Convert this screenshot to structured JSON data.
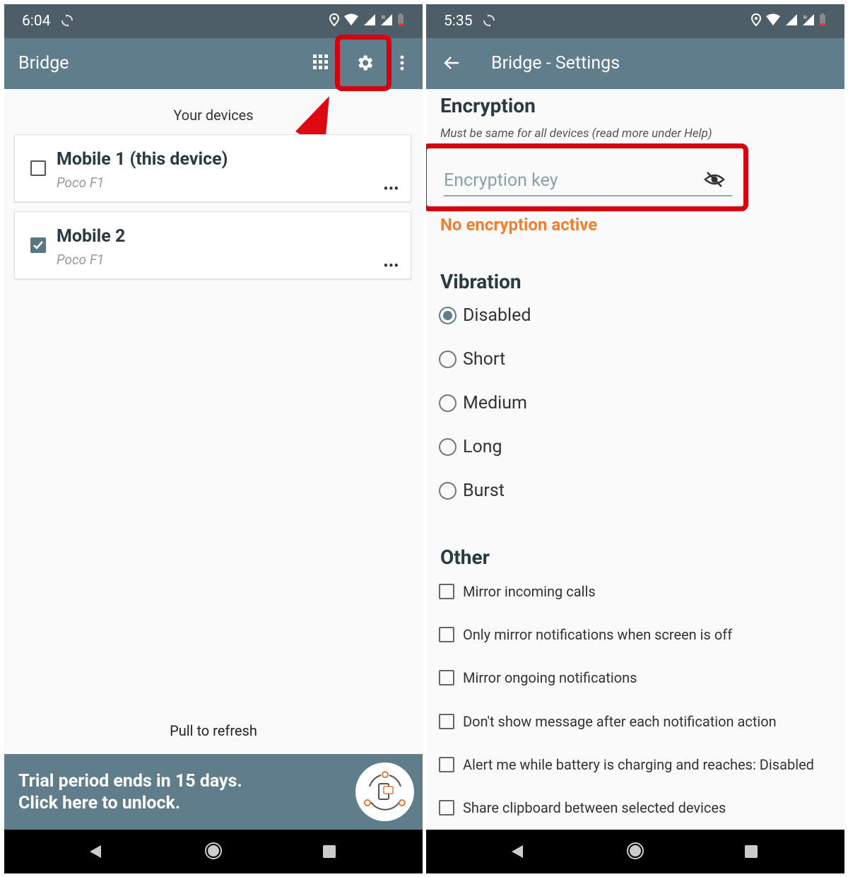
{
  "left": {
    "status_time": "6:04",
    "app_title": "Bridge",
    "section_label": "Your devices",
    "devices": [
      {
        "name": "Mobile 1 (this device)",
        "model": "Poco F1",
        "checked": false,
        "more": "•••"
      },
      {
        "name": "Mobile 2",
        "model": "Poco F1",
        "checked": true,
        "more": "•••"
      }
    ],
    "pull_to_refresh": "Pull to refresh",
    "trial_line1": "Trial period ends in 15 days.",
    "trial_line2": "Click here to unlock."
  },
  "right": {
    "status_time": "5:35",
    "app_title": "Bridge - Settings",
    "encryption": {
      "title": "Encryption",
      "hint": "Must be same for all devices (read more under Help)",
      "placeholder": "Encryption key",
      "status": "No encryption active"
    },
    "vibration": {
      "title": "Vibration",
      "options": [
        "Disabled",
        "Short",
        "Medium",
        "Long",
        "Burst"
      ],
      "selected": "Disabled"
    },
    "other": {
      "title": "Other",
      "options": [
        "Mirror incoming calls",
        "Only mirror notifications when screen is off",
        "Mirror ongoing notifications",
        "Don't show message after each notification action",
        "Alert me while battery is charging and reaches: Disabled",
        "Share clipboard between selected devices"
      ]
    }
  },
  "colors": {
    "status_bar": "#4d5e68",
    "app_bar": "#607d8b",
    "annotation_red": "#d7000f",
    "warning_orange": "#f07f2f"
  }
}
